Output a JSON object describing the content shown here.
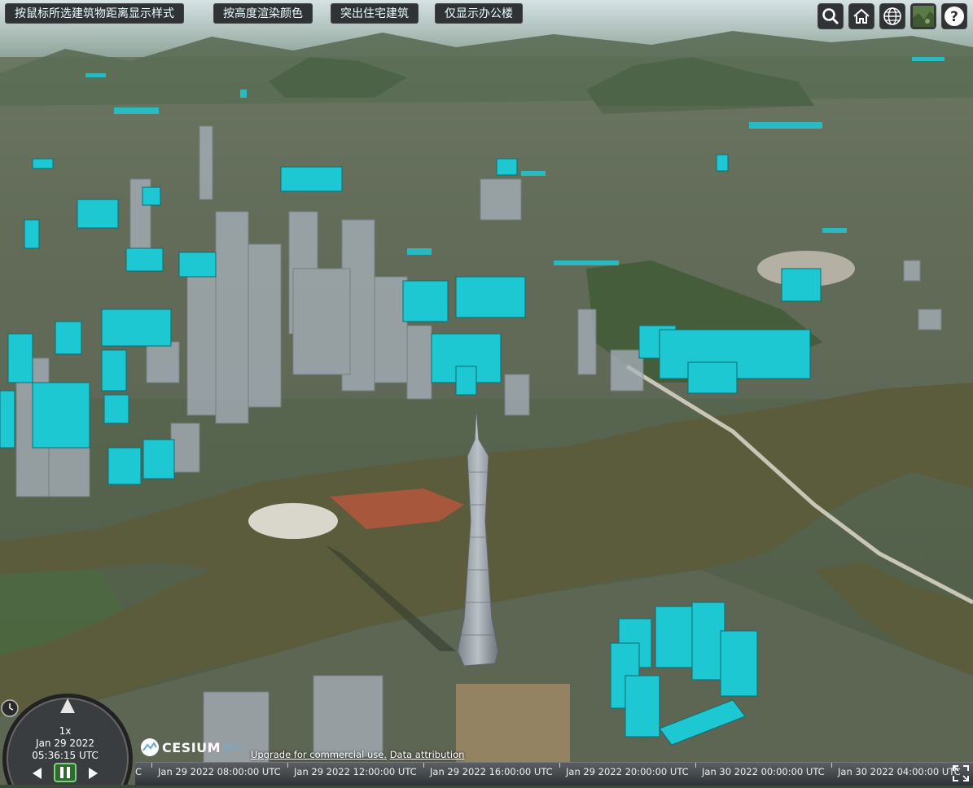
{
  "toolbar": {
    "buttons": [
      "按鼠标所选建筑物距离显示样式",
      "按高度渲染颜色",
      "突出住宅建筑",
      "仅显示办公楼"
    ]
  },
  "navigation": {
    "icons": [
      "search-icon",
      "home-icon",
      "globe-icon",
      "imagery-layer-icon",
      "help-icon"
    ],
    "help_label": "?"
  },
  "animation": {
    "speed": "1x",
    "date": "Jan 29 2022",
    "time": "05:36:15 UTC"
  },
  "timeline": {
    "labels": [
      "C",
      "Jan 29 2022 08:00:00 UTC",
      "Jan 29 2022 12:00:00 UTC",
      "Jan 29 2022 16:00:00 UTC",
      "Jan 29 2022 20:00:00 UTC",
      "Jan 30 2022 00:00:00 UTC",
      "Jan 30 2022 04:00:00 UTC"
    ]
  },
  "credits": {
    "logo_main": "CESIUM",
    "logo_sub": "ion",
    "upgrade_text": "Upgrade for commercial use.",
    "attribution_link": "Data attribution"
  },
  "colors": {
    "highlight_building": "#1ec8d2",
    "toolbar_bg": "#303336",
    "river": "#5a5a3a"
  }
}
